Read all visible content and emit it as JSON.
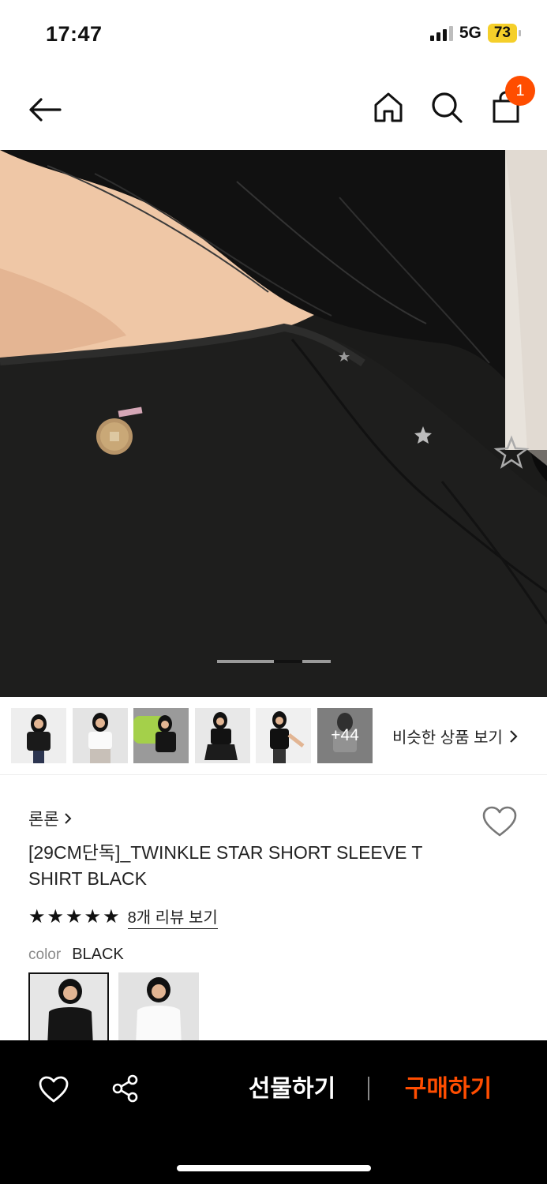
{
  "status_bar": {
    "time": "17:47",
    "network": "5G",
    "battery": "73"
  },
  "nav": {
    "back_icon": "arrow-left-icon",
    "home_icon": "home-icon",
    "search_icon": "search-icon",
    "bag_icon": "shopping-bag-icon",
    "cart_count": "1"
  },
  "gallery": {
    "current_index": 2,
    "total_dots": 3
  },
  "thumbnails": {
    "more_count": "+44",
    "similar_label": "비슷한 상품 보기"
  },
  "product": {
    "brand": "론론",
    "title": "[29CM단독]_TWINKLE STAR SHORT SLEEVE T SHIRT BLACK",
    "rating_stars": 5,
    "review_link": "8개 리뷰 보기",
    "option_label": "color",
    "option_value": "BLACK"
  },
  "actions": {
    "gift_label": "선물하기",
    "buy_label": "구매하기"
  },
  "colors": {
    "accent": "#ff4d00",
    "battery": "#f5cf2a"
  }
}
